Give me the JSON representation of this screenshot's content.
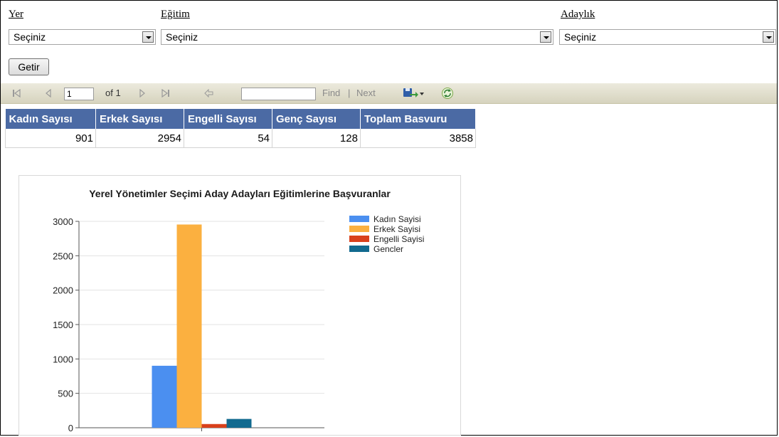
{
  "filters": {
    "yer": {
      "label": "Yer",
      "value": "Seçiniz"
    },
    "egitim": {
      "label": "Eğitim",
      "value": "Seçiniz"
    },
    "adaylik": {
      "label": "Adaylık",
      "value": "Seçiniz"
    },
    "submit_label": "Getir"
  },
  "toolbar": {
    "page_value": "1",
    "page_of": "of 1",
    "find_value": "",
    "find_label": "Find",
    "separator": "|",
    "next_label": "Next",
    "icons": [
      "first-page-icon",
      "previous-page-icon",
      "next-page-icon",
      "last-page-icon",
      "back-icon",
      "export-icon",
      "refresh-icon"
    ]
  },
  "table": {
    "headers": [
      "Kadın Sayısı",
      "Erkek Sayısı",
      "Engelli Sayısı",
      "Genç Sayısı",
      "Toplam Basvuru"
    ],
    "row": [
      "901",
      "2954",
      "54",
      "128",
      "3858"
    ],
    "header_color": "#4b6aa4"
  },
  "chart_data": {
    "type": "bar",
    "title": "Yerel Yönetimler Seçimi Aday Adayları Eğitimlerine Başvuranlar",
    "xlabel": "",
    "ylabel": "",
    "ylim": [
      0,
      3000
    ],
    "yticks": [
      "0",
      "500",
      "1000",
      "1500",
      "2000",
      "2500",
      "3000"
    ],
    "grid": true,
    "legend_position": "right",
    "series": [
      {
        "name": "Kadın Sayisi",
        "value": 901,
        "color": "#4b8ff0"
      },
      {
        "name": "Erkek Sayisi",
        "value": 2954,
        "color": "#fbb040"
      },
      {
        "name": "Engelli Sayisi",
        "value": 54,
        "color": "#d9411c"
      },
      {
        "name": "Gencler",
        "value": 128,
        "color": "#126a8f"
      }
    ]
  }
}
